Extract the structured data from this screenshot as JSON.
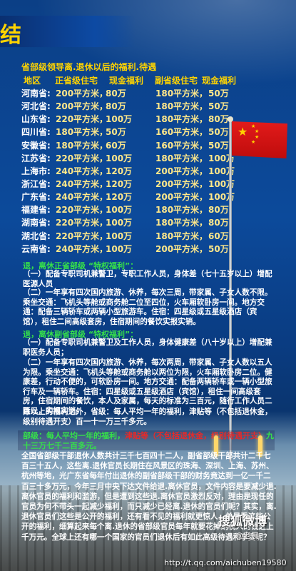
{
  "header": {
    "title_char": "结"
  },
  "section_title": "省部级领导离.退休以后的福利.待遇",
  "table": {
    "headers": [
      "地区",
      "正省级住宅",
      "现金福利",
      "副省级住宅",
      "现金福利"
    ],
    "rows": [
      [
        "河南省:",
        "200平方米，",
        "80万",
        "180平方米，",
        "50万"
      ],
      [
        "河北省:",
        "200平方米，",
        "80万",
        "180平方米，",
        "50万"
      ],
      [
        "山东省:",
        "220平方米，",
        "100万",
        "180平方米，",
        "80万"
      ],
      [
        "四川省:",
        "180平方米，",
        "50万",
        "160平方米，",
        "50万"
      ],
      [
        "安徽省:",
        "180平方米，",
        "60万",
        "160平方米，",
        "50万"
      ],
      [
        "江苏省:",
        "220平方米，",
        "100万",
        "180平方米，",
        "100万"
      ],
      [
        "上海市:",
        "240平方米，",
        "120万",
        "200平方米，",
        "100万"
      ],
      [
        "浙江省:",
        "240平方米，",
        "120万",
        "200平方米，",
        "100万"
      ],
      [
        "广东省:",
        "240平方米，",
        "120万",
        "200平方米，",
        "100万"
      ],
      [
        "福建省:",
        "220平方米，",
        "100万",
        "180平方米，",
        "80万"
      ],
      [
        "湖南省:",
        "220平方米，",
        "100万",
        "180平方米，",
        "80万"
      ],
      [
        "湖北省:",
        "220平方米，",
        "100万",
        "180平方米，",
        "60万"
      ],
      [
        "云南省:",
        "240平方米，",
        "100万",
        "200平方米，",
        "50万"
      ]
    ]
  },
  "retired": {
    "heading": "退，离休正省部级 “特权福利”：",
    "item1": "（一）配备专职司机兼警卫，专职工作人员，身体差（七十五岁以上）增配医源人员",
    "item2": "（二）一年享有四次国内旅游、休养，每次三周，带家属、子女人数不限。乘坐交通：飞机头等舱或商务舱二位至四位，火车厢软卧房一间。地方交通：配备三辆轿车或两辆小型旅游车。住宿：四星级或五星级酒店（宾馆），租住二间高级套房，住宿期间的餐饮实报实销。"
  },
  "deputy": {
    "heading": "退，离休副省部级 “特权福利”：",
    "item1": "（一）配备专职司机兼警卫及工作人员，身体健康差（八十岁以上）增配兼职医务人员；",
    "item2": "（二）一年享有四次国内旅游、休养，每次两周，带家属、子女人数以五人为限。乘坐交通：飞机头等舱或商务舱以两位为限，火车厢软卧房二位。健康差，行动不便的，可软卧房一间。地方交通：配备两辆轿车或一辆小型旅行车及一辆轿车。住宿：四星级或五星级酒店（宾馆），租住一间高级套房，住宿期间的餐饮，本人及家属，每天的标准为三百元，随行工作人员二百元，实报实销。",
    "item3": "除以上的福利之外，省级：每人平均一年的福利，津贴等（不包括退休金，级别待遇开支）百一十一万三千多元。"
  },
  "note": {
    "prefix": "部级：每人平均一年的福利，",
    "red": "津贴等（不包括退休金，级别待遇开支）",
    "suffix": "九十三万七千二百多元。"
  },
  "summary": "全国省部级干部退休人数共计三千七百四十二人，副省部级干部共计二千七百三十五人，这些离.退休官员长期住在风景区的珠海、深圳、上海、苏州、杭州等地，光广东省每年付出退休的副省部级干部的财务竟达到一亿一千二百三十多万元，今年三月中央下达文件给退.离休官员，文件内容是要减少退.离休官员的福利和滥游，但是遭到这些退.离休官员激烈反对，理由是现任的官员为何不带头一起减少福利，而只减少已经离.退休的官员们呢？其实，离.退休官员们这些是公开的福利，还有看不见的福利就更惊人，单是看这些公开的福利，细算起来每个离.退休的省部级官员每年就要花掉纳税人的钱近上千万元。全球上还有哪一个国家的官员们退休后有如此高级待遇和享受呢？",
  "watermark": {
    "brand": "搜狐微博",
    "handle": "@老晨",
    "url": "http://t.qq.com/aichuben19580"
  }
}
